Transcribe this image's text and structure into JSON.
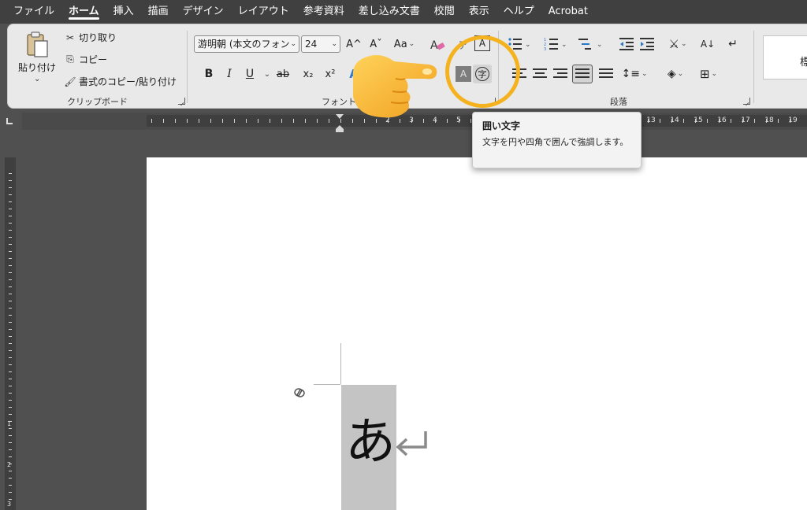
{
  "menu": {
    "tabs": [
      "ファイル",
      "ホーム",
      "挿入",
      "描画",
      "デザイン",
      "レイアウト",
      "参考資料",
      "差し込み文書",
      "校閲",
      "表示",
      "ヘルプ",
      "Acrobat"
    ],
    "active_tab": "ホーム"
  },
  "clipboard": {
    "paste_label": "貼り付け",
    "cut_label": "切り取り",
    "copy_label": "コピー",
    "format_painter_label": "書式のコピー/貼り付け",
    "group_label": "クリップボード"
  },
  "font": {
    "font_name": "游明朝 (本文のフォン",
    "font_size": "24",
    "group_label": "フォント",
    "grow_label": "A^",
    "shrink_label": "Aˇ",
    "case_label": "Aa",
    "bold_label": "B",
    "italic_label": "I",
    "underline_label": "U",
    "strike_label": "ab",
    "subscript_label": "x₂",
    "superscript_label": "x²",
    "enclosed_char_label": "字",
    "char_border_label": "A",
    "char_shading_label": "A",
    "effects_label": "A"
  },
  "paragraph": {
    "group_label": "段落"
  },
  "styles": {
    "first_style": "標"
  },
  "ruler": {
    "numbers": [
      "2",
      "3",
      "4",
      "5",
      "13",
      "14",
      "15",
      "16",
      "17",
      "18",
      "19"
    ],
    "vertical_numbers": [
      "1",
      "2",
      "3"
    ]
  },
  "document": {
    "character": "あ"
  },
  "tooltip": {
    "title": "囲い文字",
    "description": "文字を円や四角で囲んで強調します。"
  },
  "colors": {
    "highlight_ring": "#f5b21f",
    "menubar": "#404040",
    "ribbon": "#e9e9e9"
  }
}
